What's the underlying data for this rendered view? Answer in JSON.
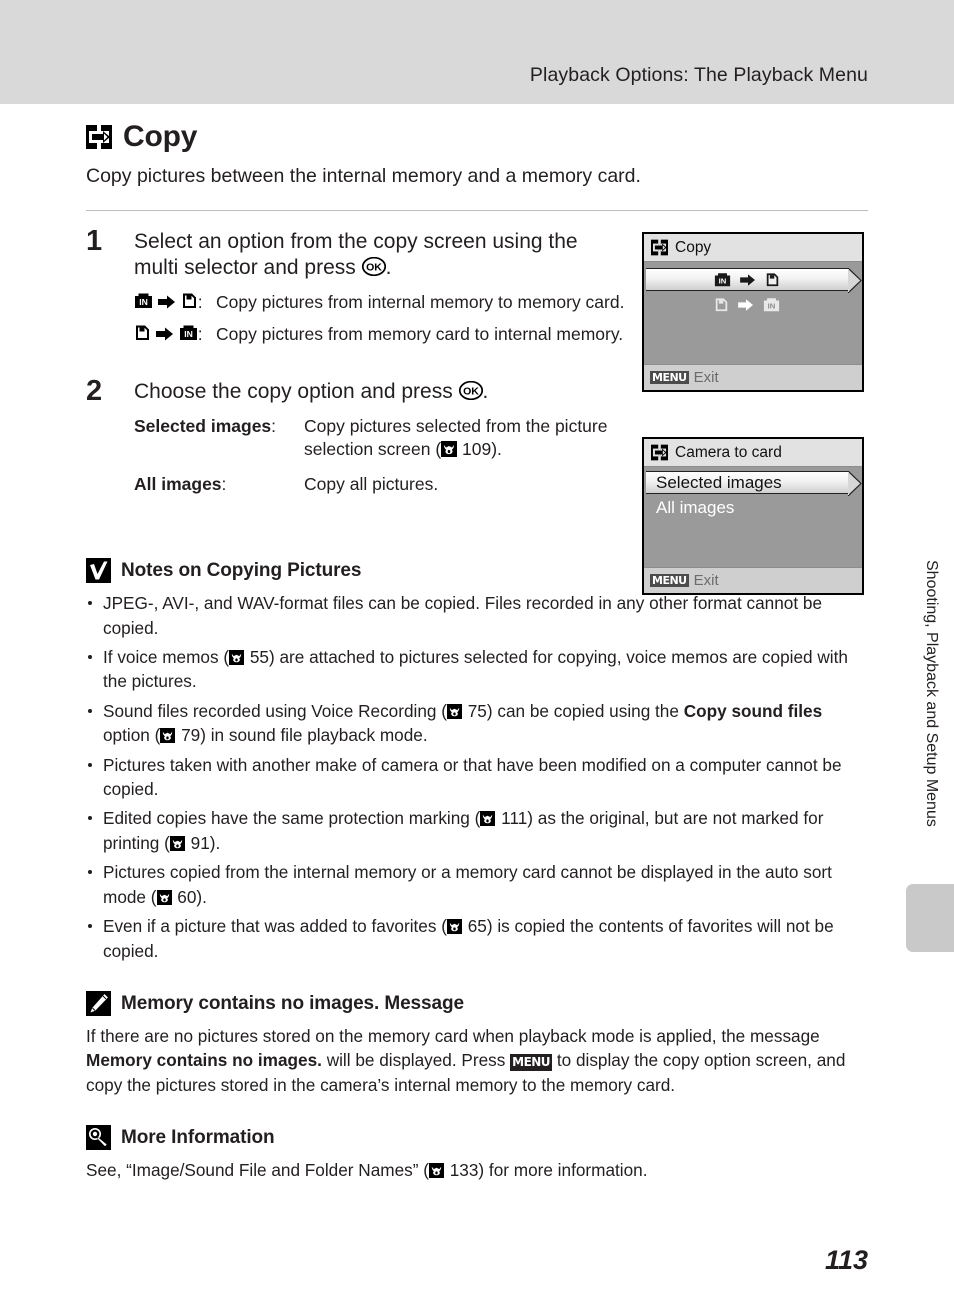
{
  "header": {
    "running_title": "Playback Options: The Playback Menu"
  },
  "section": {
    "icon": "copy-icon",
    "title": "Copy",
    "intro": "Copy pictures between the internal memory and a memory card."
  },
  "steps": [
    {
      "number": "1",
      "title_part1": "Select an option from the copy screen using the multi selector and press ",
      "title_ok": "OK",
      "title_part2": ".",
      "options": [
        {
          "from_icon": "internal-memory-icon",
          "to_icon": "memory-card-icon",
          "separator": ":",
          "description": "Copy pictures from internal memory to memory card."
        },
        {
          "from_icon": "memory-card-icon",
          "to_icon": "internal-memory-icon",
          "separator": ":",
          "description": "Copy pictures from memory card to internal memory."
        }
      ]
    },
    {
      "number": "2",
      "title_part1": "Choose the copy option and press ",
      "title_ok": "OK",
      "title_part2": ".",
      "options": [
        {
          "key": "Selected images",
          "separator": ":",
          "description_pre": "Copy pictures selected from the picture selection screen (",
          "ref_icon": "page-reference-icon",
          "ref_page": "109",
          "description_post": ")."
        },
        {
          "key": "All images",
          "separator": ":",
          "description_pre": "Copy all pictures.",
          "ref_icon": "",
          "ref_page": "",
          "description_post": ""
        }
      ]
    }
  ],
  "lcd_screens": [
    {
      "icon": "copy-icon",
      "title": "Copy",
      "rows": [
        {
          "selected": true,
          "icons": [
            "internal-memory-icon",
            "arrow-right-icon",
            "memory-card-icon"
          ]
        },
        {
          "selected": false,
          "icons": [
            "memory-card-icon",
            "arrow-right-icon",
            "internal-memory-icon"
          ]
        }
      ],
      "footer_button": "MENU",
      "footer_label": "Exit"
    },
    {
      "icon": "copy-icon",
      "title": "Camera to card",
      "rows": [
        {
          "selected": true,
          "label": "Selected images"
        },
        {
          "selected": false,
          "label": "All images"
        }
      ],
      "footer_button": "MENU",
      "footer_label": "Exit"
    }
  ],
  "notes": {
    "icon": "checkmark-icon",
    "title": "Notes on Copying Pictures",
    "items": [
      {
        "pre": "JPEG-, AVI-, and WAV-format files can be copied. Files recorded in any other format cannot be copied.",
        "ref_page": "",
        "post": "",
        "bold": "",
        "bold_post": ""
      },
      {
        "pre": "If voice memos (",
        "ref_page": "55",
        "post": ") are attached to pictures selected for copying, voice memos are copied with the pictures.",
        "bold": "",
        "bold_post": ""
      },
      {
        "pre": "Sound files recorded using Voice Recording (",
        "ref_page": "75",
        "post": ") can be copied using the ",
        "bold": "Copy sound files",
        "bold_post": " option (",
        "ref_page2": "79",
        "post2": ") in sound file playback mode."
      },
      {
        "pre": "Pictures taken with another make of camera or that have been modified on a computer cannot be copied.",
        "ref_page": "",
        "post": "",
        "bold": "",
        "bold_post": ""
      },
      {
        "pre": "Edited copies have the same protection marking (",
        "ref_page": "111",
        "post": ") as the original, but are not marked for printing (",
        "ref_page2": "91",
        "post2": ").",
        "bold": "",
        "bold_post": ""
      },
      {
        "pre": "Pictures copied from the internal memory or a memory card cannot be displayed in the auto sort mode (",
        "ref_page": "60",
        "post": ").",
        "bold": "",
        "bold_post": ""
      },
      {
        "pre": "Even if a picture that was added to favorites (",
        "ref_page": "65",
        "post": ") is copied the contents of favorites will not be copied.",
        "bold": "",
        "bold_post": ""
      }
    ]
  },
  "memory_message": {
    "icon": "pencil-icon",
    "title": "Memory contains no images. Message",
    "para_part1": "If there are no pictures stored on the memory card when playback mode is applied, the message ",
    "para_bold1": "Memory contains no images.",
    "para_part2": " will be displayed. Press ",
    "para_menu": "MENU",
    "para_part3": " to display the copy option screen, and copy the pictures stored in the camera’s internal memory to the memory card."
  },
  "more_information": {
    "icon": "magnifier-icon",
    "title": "More Information",
    "para_pre": "See, “Image/Sound File and Folder Names” (",
    "ref_page": "133",
    "para_post": ") for more information."
  },
  "side_tab": {
    "label": "Shooting, Playback and Setup Menus"
  },
  "page_number": "113",
  "colors": {
    "header_band": "#d9d9d9",
    "text": "#231f20",
    "lcd_screen": "#9a9a9a",
    "lcd_titlebar": "#e2e2e2",
    "lcd_footer": "#cfcfcf",
    "side_tab": "#c9c9c9"
  }
}
